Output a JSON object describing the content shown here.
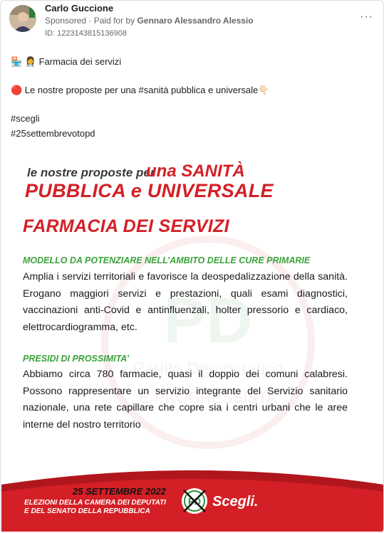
{
  "post": {
    "author": "Carlo Guccione",
    "sponsored": "Sponsored",
    "paid_by_prefix": "· Paid for by",
    "paid_by": "Gennaro Alessandro Alessio",
    "ad_id": "ID: 1223143815136908",
    "more": "···",
    "line1": "🏪 👩‍⚕️ Farmacia dei servizi",
    "line2": "🔴 Le nostre proposte per una #sanità pubblica e universale👇🏻",
    "line3": "#scegli",
    "line4": "#25settembrevotopd"
  },
  "creative": {
    "headline_a": "le nostre proposte per",
    "headline_b": "una SANITÀ",
    "headline_c": "PUBBLICA e UNIVERSALE",
    "title": "FARMACIA DEI SERVIZI",
    "section1_title": "MODELLO DA POTENZIARE NELL’AMBITO DELLE CURE PRIMARIE",
    "section1_body": "Amplia i servizi territoriali e favorisce la deospedalizzazione della sanità. Erogano maggiori servizi e prestazioni, quali esami diagnostici, vaccinazioni anti-Covid e antinfluenzali, holter pressorio e cardiaco, elettrocardiogramma, etc.",
    "section2_title": "PRESIDI DI PROSSIMITA’",
    "section2_body": "Abbiamo circa 780 farmacie, quasi il doppio dei comuni calabresi. Possono rappresentare un servizio integrante del Servizio sanitario nazionale, una rete capillare che copre sia i centri urbani che le aree interne del nostro territorio",
    "watermark_1": "Partito Democratico",
    "watermark_2": "E PROGRESSISTA",
    "footer_date": "25 SETTEMBRE 2022",
    "footer_line1": "ELEZIONI DELLA CAMERA DEI DEPUTATI",
    "footer_line2": "E DEL SENATO DELLA REPUBBLICA",
    "footer_cta": "Scegli.",
    "logo_text": "PD"
  },
  "colors": {
    "brand_red": "#d41f26",
    "accent_green": "#3aa33a",
    "meta_gray": "#65676b"
  }
}
